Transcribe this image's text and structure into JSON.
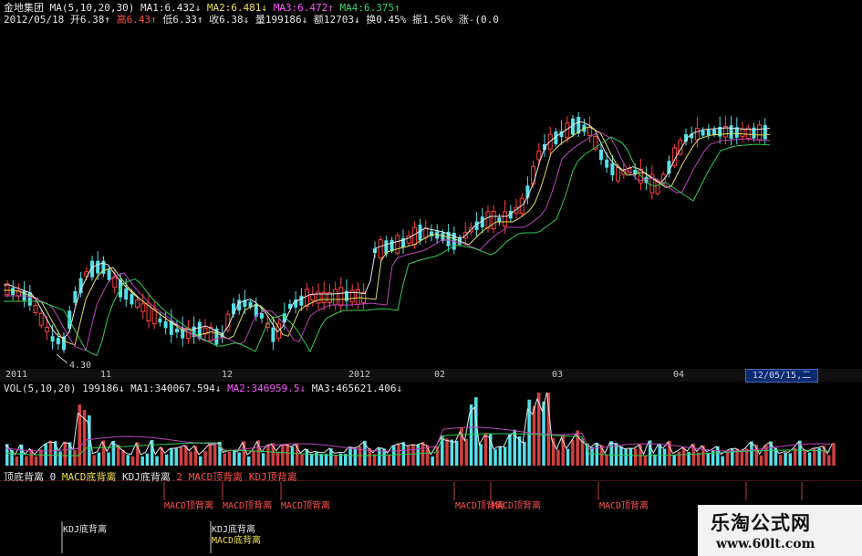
{
  "header": {
    "line1": {
      "name": "金地集团",
      "ma_label": "MA(5,10,20,30)",
      "ma1": "MA1:6.432↓",
      "ma2": "MA2:6.481↓",
      "ma3": "MA3:6.472↑",
      "ma4": "MA4:6.375↑"
    },
    "line2": {
      "date": "2012/05/18",
      "open": "开6.38↑",
      "high": "高6.43↑",
      "low": "低6.33↑",
      "close": "收6.38↓",
      "volume": "量199186↓",
      "amount": "额12703↓",
      "turnover": "换0.45%",
      "amplitude": "振1.56%",
      "change": "涨-(0.0"
    }
  },
  "price_chart": {
    "low_marker": "4.30"
  },
  "time_axis": {
    "labels": [
      "2011",
      "11",
      "12",
      "2012",
      "02",
      "03",
      "04"
    ],
    "current_date": "12/05/15,二"
  },
  "volume_header": {
    "label": "VOL(5,10,20)",
    "vol": "199186↓",
    "ma1": "MA1:340067.594↓",
    "ma2": "MA2:346959.5↓",
    "ma3": "MA3:465621.406↓"
  },
  "indicator_header": {
    "name": "顶底背离",
    "value": "0",
    "items": [
      "MACD底背离",
      "KDJ底背离",
      "2",
      "MACD顶背离",
      "KDJ顶背离"
    ]
  },
  "signals": {
    "macd_top": [
      "MACD顶背离",
      "MACD顶背离",
      "MACD顶背离",
      "MACD顶背离",
      "MACD顶背离",
      "MACD顶背离"
    ],
    "kdj_bottom": [
      "KDJ底背离",
      "KDJ底背离"
    ],
    "macd_bottom": [
      "MACD底背离"
    ]
  },
  "watermark": {
    "title": "乐淘公式网",
    "url": "www.60lt.com"
  },
  "colors": {
    "up": "#ff4040",
    "down": "#55e0e8",
    "ma1": "#e6e6e6",
    "ma2": "#e0e060",
    "ma3": "#cc44cc",
    "ma4": "#33cc55"
  }
}
